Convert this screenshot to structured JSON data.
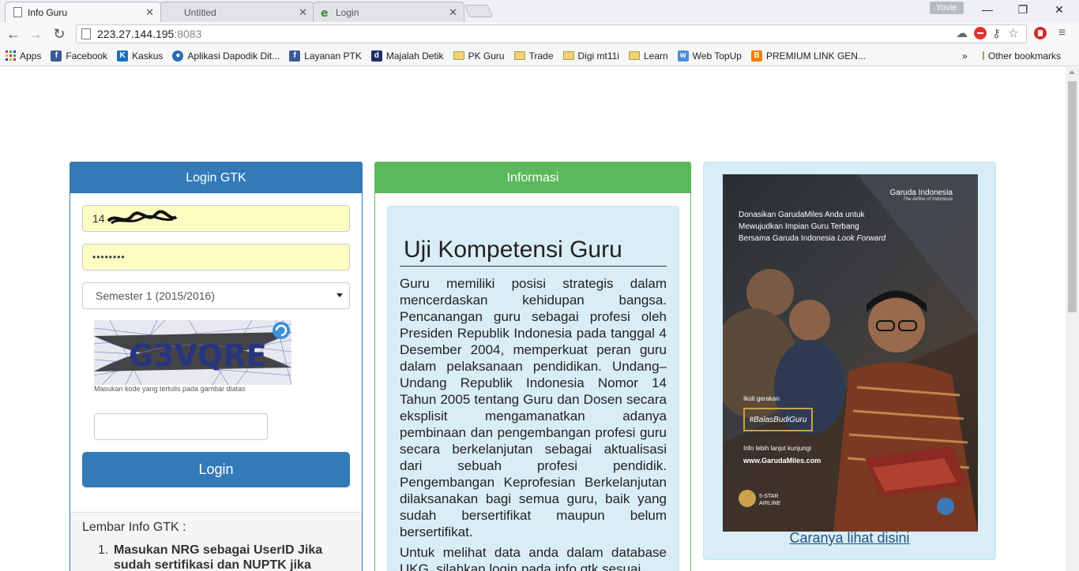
{
  "browser": {
    "tabs": [
      {
        "title": "Info Guru",
        "active": true
      },
      {
        "title": "Untitled",
        "active": false
      },
      {
        "title": "Login",
        "active": false
      }
    ],
    "profile_name": "Yovie",
    "url_host": "223.27.144.195",
    "url_port": ":8083",
    "bookmarks": [
      {
        "label": "Apps",
        "icon": "apps-grid-icon"
      },
      {
        "label": "Facebook",
        "icon": "facebook-icon"
      },
      {
        "label": "Kaskus",
        "icon": "kaskus-icon"
      },
      {
        "label": "Aplikasi Dapodik Dit...",
        "icon": "dapodik-icon"
      },
      {
        "label": "Layanan PTK",
        "icon": "facebook-icon"
      },
      {
        "label": "Majalah Detik",
        "icon": "detik-icon"
      },
      {
        "label": "PK Guru",
        "icon": "folder-icon"
      },
      {
        "label": "Trade",
        "icon": "folder-icon"
      },
      {
        "label": "Digi mt11i",
        "icon": "folder-icon"
      },
      {
        "label": "Learn",
        "icon": "folder-icon"
      },
      {
        "label": "Web TopUp",
        "icon": "web-topup-icon"
      },
      {
        "label": "PREMIUM LINK GEN...",
        "icon": "blogger-icon"
      }
    ],
    "bookmarks_overflow": "»",
    "other_bookmarks": "Other bookmarks"
  },
  "login": {
    "heading": "Login GTK",
    "username_value": "14",
    "password_value": "••••••••",
    "semester_selected": "Semester 1 (2015/2016)",
    "captcha_text": "G3VQRE",
    "captcha_hint": "Masukan kode yang tertulis pada gambar diatas",
    "captcha_input_value": "",
    "button_label": "Login",
    "info_title": "Lembar Info GTK :",
    "info_items": [
      {
        "num": "1.",
        "text": "Masukan NRG sebagai UserID Jika sudah sertifikasi dan NUPTK jika"
      }
    ]
  },
  "informasi": {
    "heading": "Informasi",
    "title": "Uji Kompetensi Guru",
    "paragraph1": "Guru memiliki posisi strategis dalam mencerdaskan kehidupan bangsa. Pencanangan guru sebagai profesi oleh Presiden Republik Indonesia pada tanggal 4 Desember 2004, memperkuat peran guru dalam pelaksanaan pendidikan. Undang–Undang Republik Indonesia Nomor 14 Tahun 2005 tentang Guru dan Dosen secara eksplisit mengamanatkan adanya pembinaan dan pengembangan profesi guru secara berkelanjutan sebagai aktualisasi dari sebuah profesi pendidik. Pengembangan Keprofesian Berkelanjutan dilaksanakan bagi semua guru, baik yang sudah bersertifikat maupun belum bersertifikat.",
    "paragraph2": "Untuk melihat data anda dalam database UKG, silahkan login pada info gtk sesuai"
  },
  "ad": {
    "brand": "Garuda Indonesia",
    "brand_sub": "The Airline of Indonesia",
    "headline_1": "Donasikan GarudaMiles Anda untuk",
    "headline_2": "Mewujudkan Impian Guru Terbang",
    "headline_3": "Bersama Garuda Indonesia",
    "headline_4": "Look Forward",
    "ikuti": "Ikuti gerakan",
    "hashtag": "#BalasBudiGuru",
    "info_lanjut": "Info lebih lanjut kunjungi",
    "url": "www.GarudaMiles.com",
    "star_label_1": "5-STAR",
    "star_label_2": "AIRLINE",
    "link_text": "Caranya lihat disini"
  },
  "colors": {
    "primary": "#337ab7",
    "success": "#5cb85c",
    "info_bg": "#d9edf7",
    "autofill": "#fbfdc2"
  }
}
